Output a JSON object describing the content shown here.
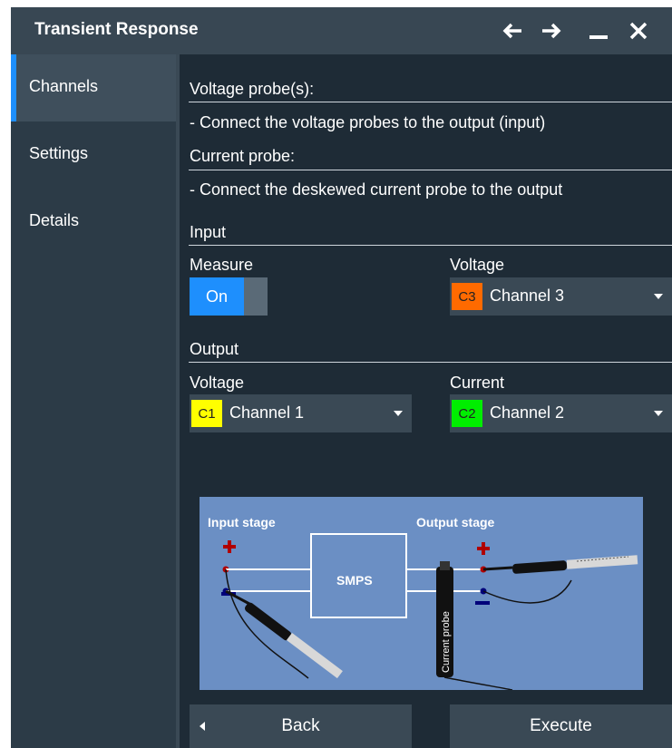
{
  "window": {
    "title": "Transient Response",
    "controls": [
      "back-arrow-icon",
      "forward-arrow-icon",
      "minimize-icon",
      "close-icon"
    ]
  },
  "sidebar": {
    "items": [
      {
        "label": "Channels",
        "active": true
      },
      {
        "label": "Settings",
        "active": false
      },
      {
        "label": "Details",
        "active": false
      }
    ]
  },
  "instructions": {
    "voltage_heading": "Voltage probe(s):",
    "voltage_text": "- Connect the voltage probes to the output (input)",
    "current_heading": "Current probe:",
    "current_text": "- Connect the deskewed current probe to the output"
  },
  "input": {
    "section_label": "Input",
    "measure_label": "Measure",
    "measure_toggle": "On",
    "voltage_label": "Voltage",
    "voltage_badge": "C3",
    "voltage_channel": "Channel 3"
  },
  "output": {
    "section_label": "Output",
    "voltage_label": "Voltage",
    "voltage_badge": "C1",
    "voltage_channel": "Channel 1",
    "current_label": "Current",
    "current_badge": "C2",
    "current_channel": "Channel 2"
  },
  "diagram": {
    "input_stage": "Input stage",
    "output_stage": "Output stage",
    "smps": "SMPS",
    "current_probe": "Current probe"
  },
  "buttons": {
    "back": "Back",
    "execute": "Execute"
  },
  "colors": {
    "accent": "#1e8ffd",
    "c1": "#ffff00",
    "c2": "#00ee00",
    "c3": "#ff6a00"
  }
}
